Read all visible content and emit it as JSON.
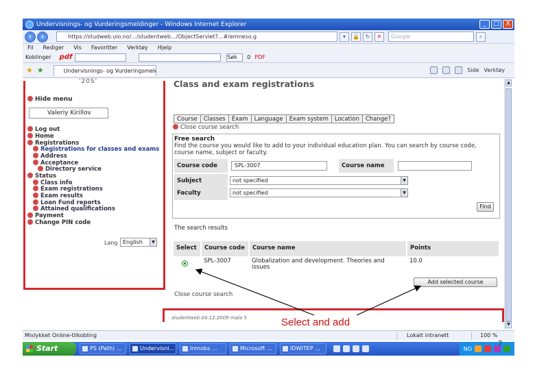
{
  "browser": {
    "title": "Undervisnings- og Vurderingsmeldinger - Windows Internet Explorer",
    "win_min": "_",
    "win_max": "□",
    "win_close": "X",
    "nav_back": "‹",
    "nav_fwd": "›",
    "address": "https://studweb.uio.no/.../studentweb.../ObjectServlet?...#/emneso.g",
    "search_placeholder": "Google",
    "menu": [
      "Fil",
      "Rediger",
      "Vis",
      "Favoritter",
      "Verktøy",
      "Hjelp"
    ],
    "toolbar2": {
      "label": "Koblinger",
      "pdf": "pdf",
      "search_label": "Søk",
      "count": "0",
      "pdf_label": "PDF"
    },
    "tab_title": "Undervisnings- og Vurderingsmeldinger",
    "fav_right": [
      "Side",
      "Verktøy"
    ]
  },
  "page": {
    "logo_text": "'20S'",
    "hide_menu": "Hide menu",
    "username": "Valeriy Kirillov",
    "menu": {
      "log_out": "Log out",
      "home": "Home",
      "registrations": "Registrations",
      "reg_classes_exams": "Registrations for classes and exams",
      "address": "Address",
      "acceptance": "Acceptance",
      "directory_service": "Directory service",
      "status": "Status",
      "class_info": "Class info",
      "exam_registrations": "Exam registrations",
      "exam_results": "Exam results",
      "loan_fund_reports": "Loan Fund reports",
      "attained_qualifications": "Attained qualifications",
      "payment": "Payment",
      "change_pin": "Change PIN code"
    },
    "lang_label": "Lang",
    "lang_value": "English",
    "title": "Class and exam registrations",
    "tabs": [
      "Course",
      "Classes",
      "Exam",
      "Language",
      "Exam system",
      "Location",
      "Change?"
    ],
    "close_course_search": "Close course search",
    "free_search": {
      "title": "Free search",
      "description": "Find the course you would like to add to your individual education plan. You can search by course code, course name, subject or faculty.",
      "course_code_label": "Course code",
      "course_code_value": "SPL-3007",
      "course_name_label": "Course name",
      "course_name_value": "",
      "subject_label": "Subject",
      "subject_value": "not specified",
      "faculty_label": "Faculty",
      "faculty_value": "not specified",
      "find_button": "Find"
    },
    "results_label": "The search results",
    "results": {
      "columns": [
        "Select",
        "Course code",
        "Course name",
        "Points"
      ],
      "rows": [
        {
          "code": "SPL-3007",
          "name": "Globalization and development. Theories and issues",
          "points": "10.0"
        }
      ]
    },
    "add_button": "Add selected course",
    "close_course_search_bottom": "Close course search",
    "footer": "studentweb  04.12.2009  mala  5"
  },
  "annotation": "Select and add",
  "status": {
    "text": "Mislykket Online-tilkobling",
    "zone": "Lokalt intranett",
    "zoom": "100 %"
  },
  "taskbar": {
    "start": "Start",
    "items": [
      "PS (Path) ...",
      "Undervisni...",
      "Inmobs ...",
      "Microsoft ...",
      "IDWITEP ..."
    ],
    "lang": "NO"
  },
  "page_number": "7"
}
